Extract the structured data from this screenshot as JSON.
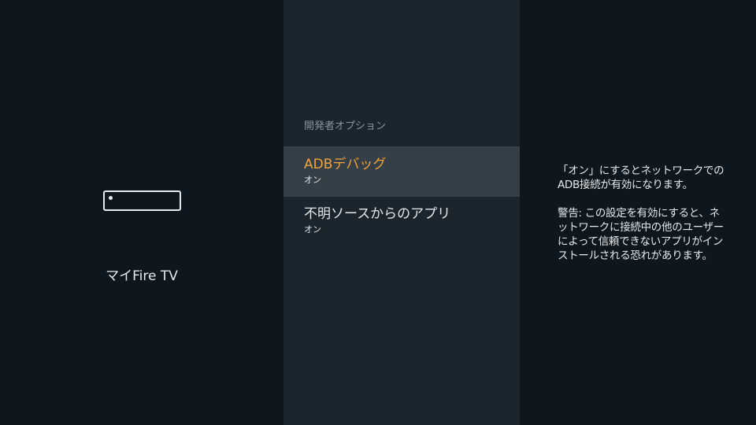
{
  "left_panel": {
    "device_name": "マイFire TV",
    "device_icon": "fire-tv-device-icon"
  },
  "middle_panel": {
    "section_title": "開発者オプション",
    "items": [
      {
        "label": "ADBデバッグ",
        "value": "オン",
        "selected": true
      },
      {
        "label": "不明ソースからのアプリ",
        "value": "オン",
        "selected": false
      }
    ]
  },
  "right_panel": {
    "description": "「オン」にするとネットワークでのADB接続が有効になります。",
    "warning": "警告: この設定を有効にすると、ネットワークに接続中の他のユーザーによって信頼できないアプリがインストールされる恐れがあります。"
  },
  "colors": {
    "background": "#0f171e",
    "middle_panel": "#1b252e",
    "selected_row": "#353f47",
    "accent": "#f0a33a",
    "text": "#e6e9ea",
    "muted_text": "#8a949b"
  }
}
